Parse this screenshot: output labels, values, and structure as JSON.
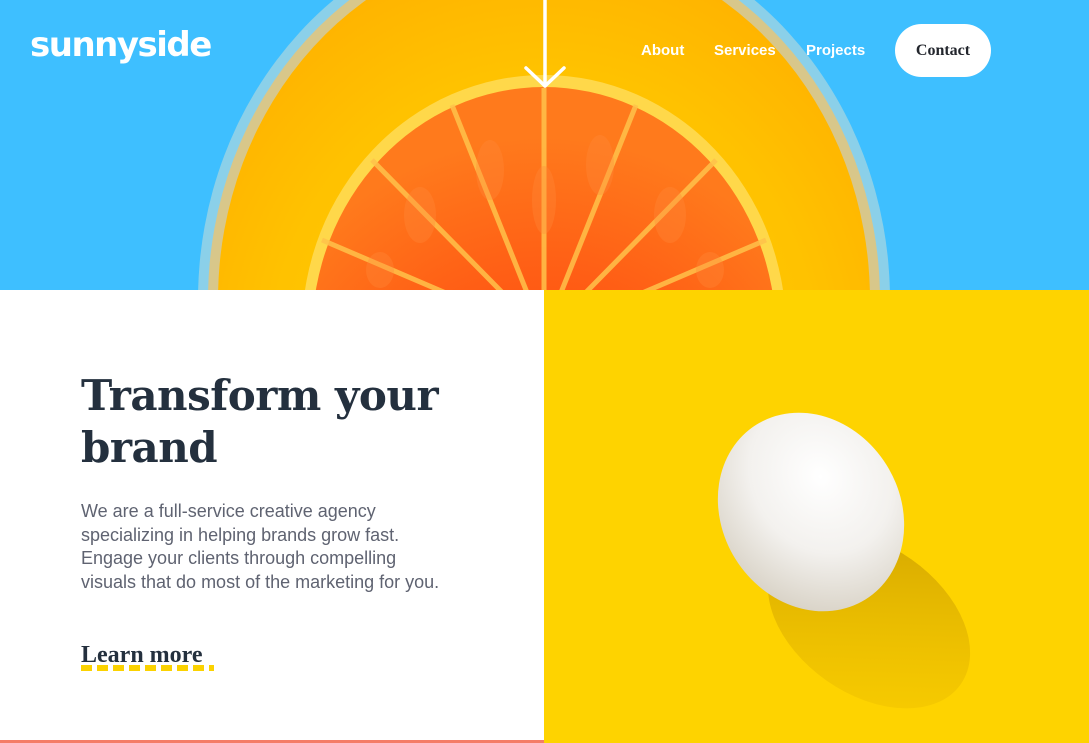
{
  "brand": {
    "logo": "sunnyside"
  },
  "nav": {
    "items": [
      "About",
      "Services",
      "Projects"
    ],
    "contact_label": "Contact"
  },
  "icons": {
    "scroll_indicator": "arrow-down-icon",
    "hero_image": "orange-slice-image",
    "feature_image": "egg-image"
  },
  "feature": {
    "headline_line1": "Transform your",
    "headline_line2": "brand",
    "body": "We are a full-service creative agency specializing in helping brands grow fast. Engage your clients through compelling visuals that do most of the marketing for you.",
    "link_label": "Learn more"
  },
  "colors": {
    "sky_blue": "#3ebfff",
    "orange": "#ff5a1a",
    "yellow": "#fed300",
    "dark_text": "#24303e",
    "body_text": "#5f6371",
    "underline_yellow": "#fbd200",
    "coral": "#f47d68"
  }
}
